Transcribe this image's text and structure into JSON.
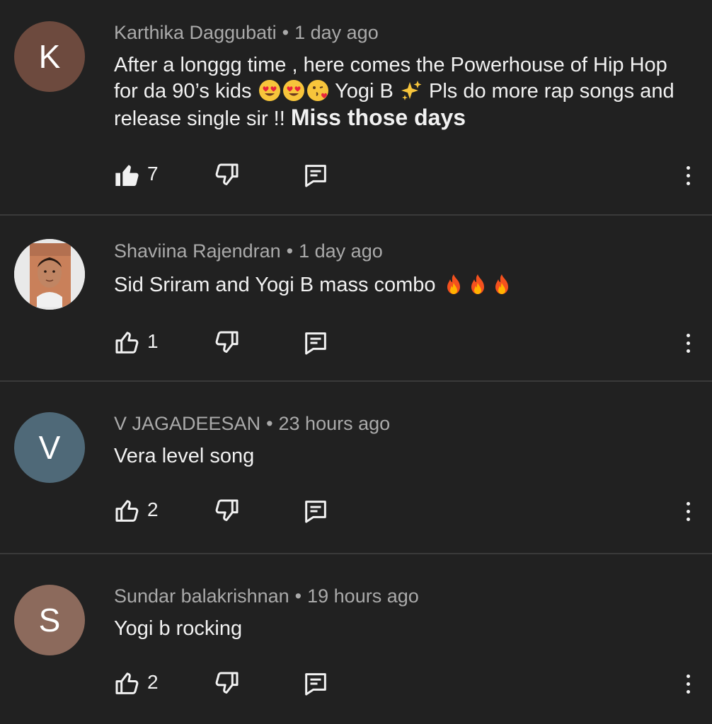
{
  "comments": [
    {
      "avatar_letter": "K",
      "avatar_color": "#6d4a3e",
      "author": "Karthika Daggubati",
      "time": "1 day ago",
      "text_part1": "After a longgg time , here comes the Powerhouse of Hip Hop for da 90’s kids ",
      "text_part2": " Yogi B ",
      "text_part3": " Pls do more rap songs and release single sir !! ",
      "text_emphasis": "Miss those days",
      "emojis": [
        "heart-eyes-emoji",
        "heart-eyes-emoji",
        "kissing-heart-emoji",
        "sparkles-emoji"
      ],
      "likes": "7",
      "liked": true
    },
    {
      "avatar_type": "photo",
      "author": "Shaviina Rajendran",
      "time": "1 day ago",
      "text": "Sid Sriram and Yogi B mass combo ",
      "emojis": [
        "fire-emoji",
        "fire-emoji",
        "fire-emoji"
      ],
      "likes": "1",
      "liked": false
    },
    {
      "avatar_letter": "V",
      "avatar_color": "#4f6978",
      "author": "V JAGADEESAN",
      "time": "23 hours ago",
      "text": "Vera level song",
      "likes": "2",
      "liked": false
    },
    {
      "avatar_letter": "S",
      "avatar_color": "#8c6a5c",
      "author": "Sundar balakrishnan",
      "time": "19 hours ago",
      "text": "Yogi b rocking",
      "likes": "2",
      "liked": false
    }
  ],
  "separator": "•"
}
